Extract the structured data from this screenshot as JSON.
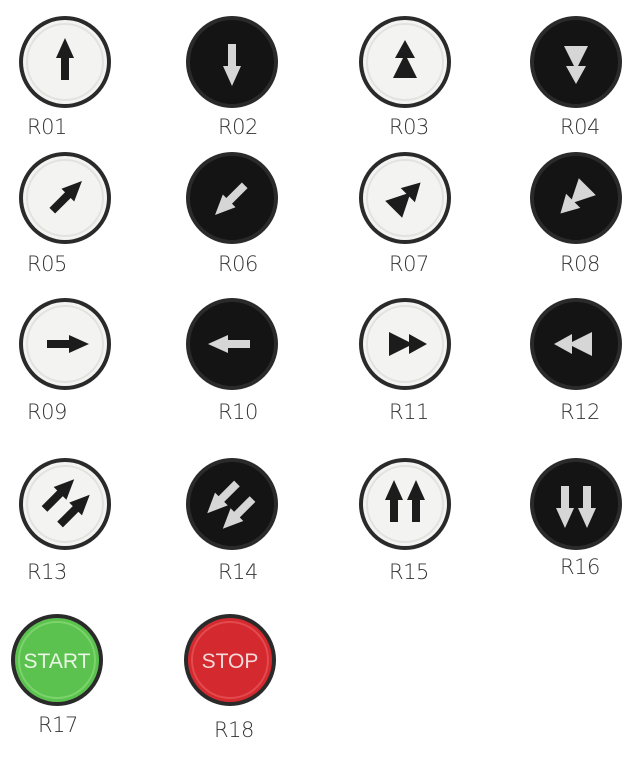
{
  "buttons": [
    {
      "code": "R01",
      "face": "light",
      "icon": "arrow-up-icon"
    },
    {
      "code": "R02",
      "face": "dark",
      "icon": "arrow-down-icon"
    },
    {
      "code": "R03",
      "face": "light",
      "icon": "double-triangle-up-icon"
    },
    {
      "code": "R04",
      "face": "dark",
      "icon": "double-triangle-down-icon"
    },
    {
      "code": "R05",
      "face": "light",
      "icon": "arrow-up-right-icon"
    },
    {
      "code": "R06",
      "face": "dark",
      "icon": "arrow-down-left-icon"
    },
    {
      "code": "R07",
      "face": "light",
      "icon": "double-triangle-up-right-icon"
    },
    {
      "code": "R08",
      "face": "dark",
      "icon": "double-triangle-down-left-icon"
    },
    {
      "code": "R09",
      "face": "light",
      "icon": "arrow-right-icon"
    },
    {
      "code": "R10",
      "face": "dark",
      "icon": "arrow-left-icon"
    },
    {
      "code": "R11",
      "face": "light",
      "icon": "double-triangle-right-icon"
    },
    {
      "code": "R12",
      "face": "dark",
      "icon": "double-triangle-left-icon"
    },
    {
      "code": "R13",
      "face": "light",
      "icon": "double-arrow-up-right-icon"
    },
    {
      "code": "R14",
      "face": "dark",
      "icon": "double-arrow-down-left-icon"
    },
    {
      "code": "R15",
      "face": "light",
      "icon": "double-arrow-up-icon"
    },
    {
      "code": "R16",
      "face": "dark",
      "icon": "double-arrow-down-icon"
    },
    {
      "code": "R17",
      "face": "green",
      "icon": "start-text-icon",
      "text": "START"
    },
    {
      "code": "R18",
      "face": "red",
      "icon": "stop-text-icon",
      "text": "STOP"
    }
  ],
  "colors": {
    "light_face": "#f3f3f1",
    "dark_face": "#141414",
    "bezel": "#2a2a2a",
    "green_face": "#5cc24f",
    "red_face": "#d42a2f",
    "glyph_dark": "#1c1c1c",
    "glyph_light": "#d6d6d6"
  }
}
